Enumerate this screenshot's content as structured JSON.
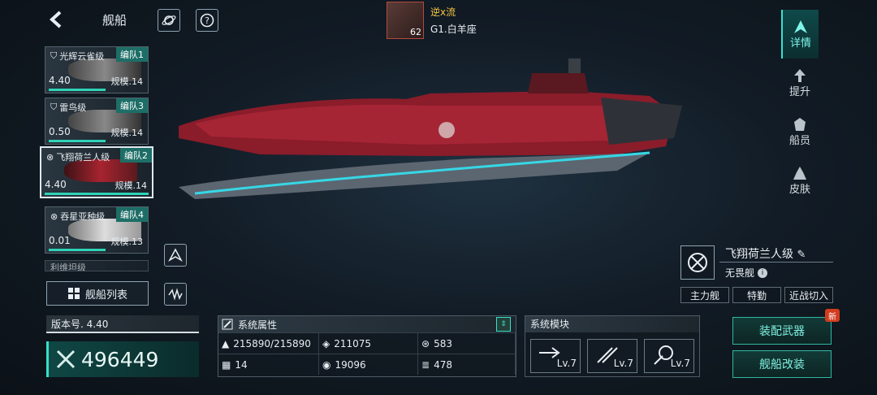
{
  "header": {
    "title": "舰船"
  },
  "player": {
    "name": "逆x流",
    "level": "62",
    "rank": "G1.白羊座"
  },
  "tabs": [
    {
      "label": "详情",
      "active": true
    },
    {
      "label": "提升"
    },
    {
      "label": "船员"
    },
    {
      "label": "皮肤"
    }
  ],
  "ships": [
    {
      "name": "光辉云雀级",
      "fleet": "编队1",
      "value": "4.40",
      "scale": "规模.14"
    },
    {
      "name": "雷鸟级",
      "fleet": "编队3",
      "value": "0.50",
      "scale": "规模.14"
    },
    {
      "name": "飞翔荷兰人级",
      "fleet": "编队2",
      "value": "4.40",
      "scale": "规模.14"
    },
    {
      "name": "吞星亚种级",
      "fleet": "编队4",
      "value": "0.01",
      "scale": "规模.13"
    },
    {
      "name": "利维坦级"
    }
  ],
  "list_button": "舰船列表",
  "selected": {
    "name": "飞翔荷兰人级",
    "class": "无畏舰",
    "roles": [
      "主力舰",
      "特勤",
      "近战切入"
    ]
  },
  "version": "版本号. 4.40",
  "power": "496449",
  "attributes": {
    "title": "系统属性",
    "values": [
      "215890/215890",
      "211075",
      "583",
      "14",
      "19096",
      "478"
    ]
  },
  "modules": {
    "title": "系统模块",
    "levels": [
      "Lv.7",
      "Lv.7",
      "Lv.7"
    ]
  },
  "buttons": {
    "equip": "装配武器",
    "modify": "舰船改装",
    "new": "新"
  },
  "colors": {
    "accent": "#36e0c8",
    "ship": "#a72430",
    "gold": "#f5c542"
  }
}
